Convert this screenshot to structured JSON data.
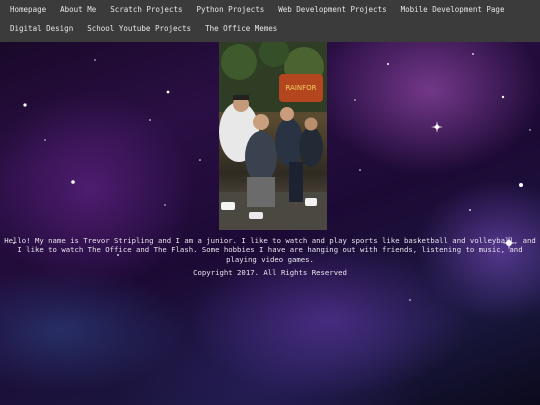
{
  "nav": {
    "items": [
      {
        "label": "Homepage"
      },
      {
        "label": "About Me"
      },
      {
        "label": "Scratch Projects"
      },
      {
        "label": "Python Projects"
      },
      {
        "label": "Web Development Projects"
      },
      {
        "label": "Mobile Development Page"
      },
      {
        "label": "Digital Design"
      },
      {
        "label": "School Youtube Projects"
      },
      {
        "label": "The Office Memes"
      }
    ]
  },
  "main": {
    "bio": "Hello! My name is Trevor Stripling and I am a junior. I like to watch and play sports like basketball and volleyball, and I like to watch The Office and The Flash. Some hobbies I have are hanging out with friends, listening to music, and playing video games.",
    "copyright": "Copyright 2017. All Rights Reserved"
  }
}
